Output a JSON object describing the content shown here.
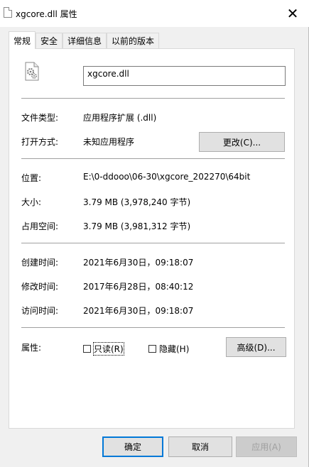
{
  "window": {
    "title": "xgcore.dll 属性",
    "close_glyph": "✕"
  },
  "tabs": [
    {
      "label": "常规",
      "active": true
    },
    {
      "label": "安全",
      "active": false
    },
    {
      "label": "详细信息",
      "active": false
    },
    {
      "label": "以前的版本",
      "active": false
    }
  ],
  "general": {
    "file_name": "xgcore.dll",
    "file_type_label": "文件类型:",
    "file_type_value": "应用程序扩展 (.dll)",
    "opens_with_label": "打开方式:",
    "opens_with_value": "未知应用程序",
    "change_button": "更改(C)...",
    "location_label": "位置:",
    "location_value": "E:\\0-ddooo\\06-30\\xgcore_202270\\64bit",
    "size_label": "大小:",
    "size_value": "3.79 MB (3,978,240 字节)",
    "size_on_disk_label": "占用空间:",
    "size_on_disk_value": "3.79 MB (3,981,312 字节)",
    "created_label": "创建时间:",
    "created_value": "2021年6月30日，09:18:07",
    "modified_label": "修改时间:",
    "modified_value": "2017年6月28日，08:40:12",
    "accessed_label": "访问时间:",
    "accessed_value": "2021年6月30日，09:18:07",
    "attributes_label": "属性:",
    "readonly_label": "只读(R)",
    "readonly_checked": false,
    "hidden_label": "隐藏(H)",
    "hidden_checked": false,
    "advanced_button": "高级(D)..."
  },
  "footer": {
    "ok_button": "确定",
    "cancel_button": "取消",
    "apply_button": "应用(A)",
    "apply_enabled": false
  },
  "colors": {
    "accent": "#0078d7",
    "panel_bg": "#ffffff",
    "dialog_bg": "#f0f0f0"
  }
}
